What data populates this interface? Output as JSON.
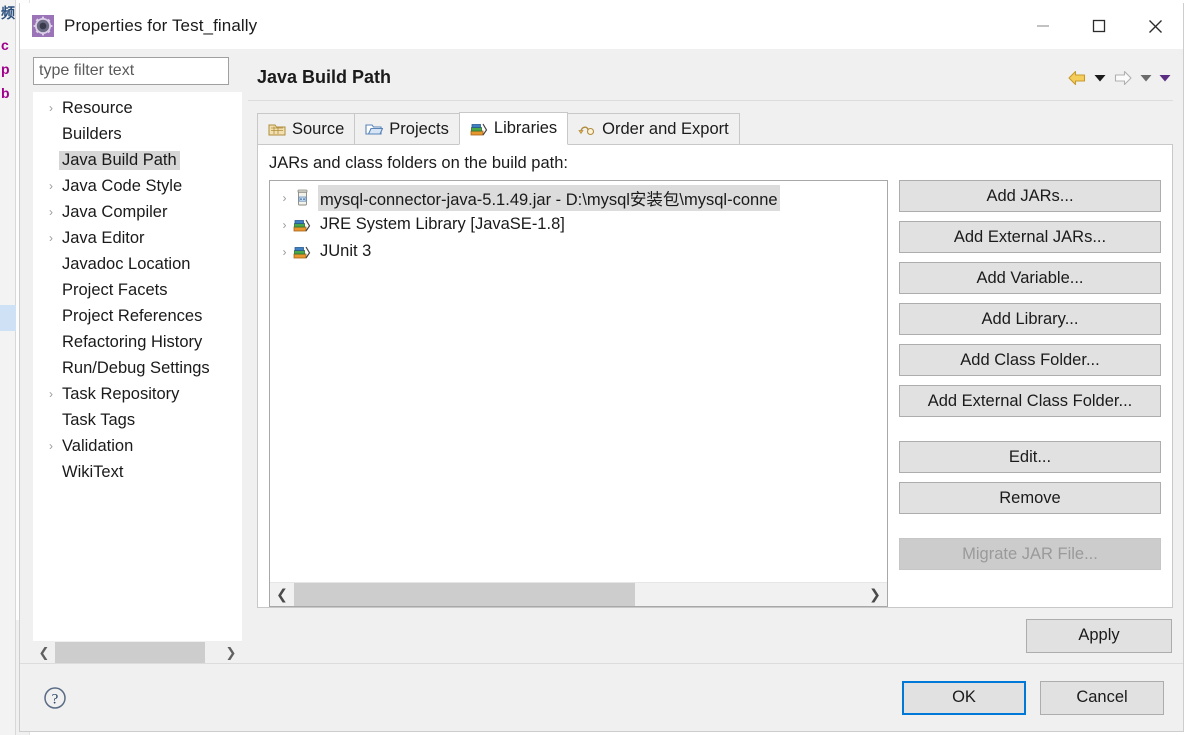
{
  "background": {
    "glyphs": [
      "频",
      "c",
      "p",
      "b"
    ]
  },
  "window": {
    "title": "Properties for Test_finally",
    "icon": "eclipse-properties-icon",
    "controls": {
      "minimize": "minimize-icon",
      "maximize": "maximize-icon",
      "close": "close-icon"
    }
  },
  "sidebar": {
    "filter": {
      "placeholder": "type filter text",
      "value": "type filter text"
    },
    "items": [
      {
        "label": "Resource",
        "expandable": true,
        "selected": false
      },
      {
        "label": "Builders",
        "expandable": false,
        "selected": false
      },
      {
        "label": "Java Build Path",
        "expandable": false,
        "selected": true
      },
      {
        "label": "Java Code Style",
        "expandable": true,
        "selected": false
      },
      {
        "label": "Java Compiler",
        "expandable": true,
        "selected": false
      },
      {
        "label": "Java Editor",
        "expandable": true,
        "selected": false
      },
      {
        "label": "Javadoc Location",
        "expandable": false,
        "selected": false
      },
      {
        "label": "Project Facets",
        "expandable": false,
        "selected": false
      },
      {
        "label": "Project References",
        "expandable": false,
        "selected": false
      },
      {
        "label": "Refactoring History",
        "expandable": false,
        "selected": false
      },
      {
        "label": "Run/Debug Settings",
        "expandable": false,
        "selected": false
      },
      {
        "label": "Task Repository",
        "expandable": true,
        "selected": false
      },
      {
        "label": "Task Tags",
        "expandable": false,
        "selected": false
      },
      {
        "label": "Validation",
        "expandable": true,
        "selected": false
      },
      {
        "label": "WikiText",
        "expandable": false,
        "selected": false
      }
    ],
    "scrollbar": {
      "left_arrow": "chevron-left-icon",
      "right_arrow": "chevron-right-icon"
    }
  },
  "page": {
    "title": "Java Build Path",
    "nav": {
      "back": "back-arrow-icon",
      "back_menu": "chevron-down-icon",
      "forward": "forward-arrow-icon",
      "forward_menu": "chevron-down-icon",
      "view_menu": "chevron-down-icon"
    }
  },
  "tabs": [
    {
      "label": "Source",
      "icon": "source-folder-icon",
      "active": false
    },
    {
      "label": "Projects",
      "icon": "projects-folder-icon",
      "active": false
    },
    {
      "label": "Libraries",
      "icon": "libraries-books-icon",
      "active": true
    },
    {
      "label": "Order and Export",
      "icon": "order-export-icon",
      "active": false
    }
  ],
  "libraries_panel": {
    "caption": "JARs and class folders on the build path:",
    "entries": [
      {
        "label": "mysql-connector-java-5.1.49.jar - D:\\mysql安装包\\mysql-conne",
        "icon": "jar-icon",
        "expandable": true,
        "selected": true
      },
      {
        "label": "JRE System Library [JavaSE-1.8]",
        "icon": "library-books-icon",
        "expandable": true,
        "selected": false
      },
      {
        "label": "JUnit 3",
        "icon": "library-books-icon",
        "expandable": true,
        "selected": false
      }
    ],
    "scrollbar": {
      "left_arrow": "chevron-left-icon",
      "right_arrow": "chevron-right-icon"
    },
    "buttons": [
      {
        "label": "Add JARs...",
        "enabled": true,
        "gap_above": false
      },
      {
        "label": "Add External JARs...",
        "enabled": true,
        "gap_above": false
      },
      {
        "label": "Add Variable...",
        "enabled": true,
        "gap_above": false
      },
      {
        "label": "Add Library...",
        "enabled": true,
        "gap_above": false
      },
      {
        "label": "Add Class Folder...",
        "enabled": true,
        "gap_above": false
      },
      {
        "label": "Add External Class Folder...",
        "enabled": true,
        "gap_above": false
      },
      {
        "label": "Edit...",
        "enabled": true,
        "gap_above": true
      },
      {
        "label": "Remove",
        "enabled": true,
        "gap_above": false
      },
      {
        "label": "Migrate JAR File...",
        "enabled": false,
        "gap_above": true
      }
    ]
  },
  "apply": {
    "label": "Apply"
  },
  "footer": {
    "help_icon": "help-question-icon",
    "ok": "OK",
    "cancel": "Cancel"
  },
  "colors": {
    "focus_blue": "#0078d7",
    "selection_gray": "#d6d6d6",
    "button_face": "#e1e1e1",
    "dialog_face": "#f0f0f0"
  }
}
